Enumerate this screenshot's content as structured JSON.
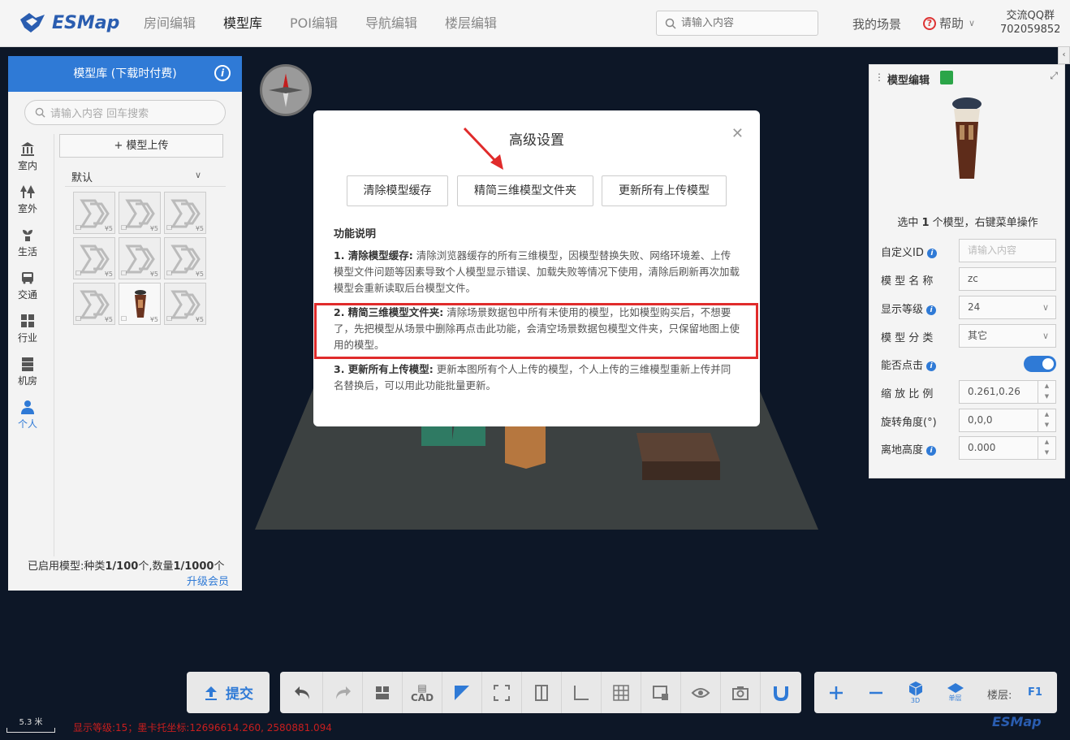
{
  "brand": {
    "name": "ESMap"
  },
  "nav": {
    "items": [
      "房间编辑",
      "模型库",
      "POI编辑",
      "导航编辑",
      "楼层编辑"
    ],
    "active_index": 1
  },
  "search": {
    "placeholder": "请输入内容"
  },
  "header_right": {
    "my_scene": "我的场景",
    "help": "帮助",
    "qq_label": "交流QQ群",
    "qq_number": "702059852"
  },
  "left_panel": {
    "title": "模型库 (下载时付费)",
    "search_placeholder": "请输入内容 回车搜索",
    "tabs": [
      "室内",
      "室外",
      "生活",
      "交通",
      "行业",
      "机房",
      "个人"
    ],
    "active_tab": "个人",
    "upload_label": "模型上传",
    "category": "默认",
    "model_price": "¥5",
    "footer_prefix": "已启用模型:种类",
    "footer_types": "1/100",
    "footer_mid": "个,数量",
    "footer_count": "1/1000",
    "footer_suffix": "个",
    "upgrade": "升级会员"
  },
  "modal": {
    "title": "高级设置",
    "buttons": [
      "清除模型缓存",
      "精简三维模型文件夹",
      "更新所有上传模型"
    ],
    "desc_title": "功能说明",
    "items": [
      {
        "head": "1. 清除模型缓存:",
        "text": "清除浏览器缓存的所有三维模型，因模型替换失败、网络环境差、上传模型文件问题等因素导致个人模型显示错误、加载失败等情况下使用，清除后刷新再次加载模型会重新读取后台模型文件。"
      },
      {
        "head": "2. 精简三维模型文件夹:",
        "text": "清除场景数据包中所有未使用的模型，比如模型购买后，不想要了，先把模型从场景中删除再点击此功能，会清空场景数据包模型文件夹，只保留地图上使用的模型。"
      },
      {
        "head": "3. 更新所有上传模型:",
        "text": "更新本图所有个人上传的模型，个人上传的三维模型重新上传并同名替换后，可以用此功能批量更新。"
      }
    ]
  },
  "right_panel": {
    "title": "模型编辑",
    "selected_prefix": "选中 ",
    "selected_count": "1",
    "selected_suffix": " 个模型，右键菜单操作",
    "rows": [
      {
        "label": "自定义ID",
        "info": true,
        "value": "",
        "placeholder": "请输入内容"
      },
      {
        "label": "模 型 名 称",
        "info": false,
        "value": "zc"
      },
      {
        "label": "显示等级",
        "info": true,
        "value": "24"
      },
      {
        "label": "模 型 分 类",
        "info": false,
        "value": "其它"
      },
      {
        "label": "能否点击",
        "info": true,
        "toggle": true
      },
      {
        "label": "缩 放 比 例",
        "info": false,
        "value": "0.261,0.26"
      },
      {
        "label": "旋转角度(°)",
        "info": false,
        "value": "0,0,0"
      },
      {
        "label": "离地高度",
        "info": true,
        "value": "0.000"
      }
    ]
  },
  "toolbar": {
    "submit": "提交",
    "cad": "CAD",
    "view_3d": "3D",
    "view_single": "单层",
    "floor_label": "楼层:",
    "floor_value": "F1"
  },
  "status": {
    "scale": "5.3 米",
    "text": "显示等级:15；墨卡托坐标:12696614.260, 2580881.094"
  },
  "colors": {
    "accent": "#2f7ad6",
    "highlight": "#e02b2b",
    "background": "#0d1727"
  }
}
